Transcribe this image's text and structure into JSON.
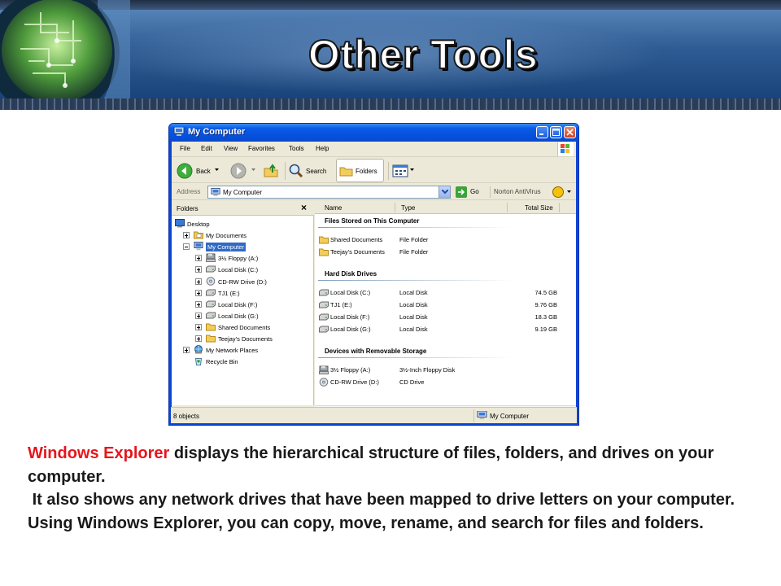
{
  "slide": {
    "title": "Other Tools",
    "paragraphs": [
      {
        "highlight": "Windows Explorer",
        "rest": " displays the hierarchical structure of files, folders, and drives on your computer."
      },
      {
        "text": " It also shows any network drives that have been mapped to drive letters on your computer."
      },
      {
        "text": "Using Windows Explorer, you can copy, move, rename, and search for files and folders."
      }
    ],
    "colors": {
      "header_blue": "#2e5b93",
      "highlight_red": "#e8141c",
      "xp_blue": "#0a5ce8",
      "selection": "#316ac5"
    }
  },
  "window": {
    "title": "My Computer",
    "menu": [
      "File",
      "Edit",
      "View",
      "Favorites",
      "Tools",
      "Help"
    ],
    "toolbar": {
      "back": "Back",
      "search": "Search",
      "folders": "Folders"
    },
    "address": {
      "label": "Address",
      "value": "My Computer",
      "go": "Go",
      "antivirus": "Norton AntiVirus"
    },
    "folders_pane": {
      "title": "Folders",
      "tree": [
        "Desktop",
        "My Documents",
        "My Computer",
        "3½ Floppy (A:)",
        "Local Disk (C:)",
        "CD-RW Drive (D:)",
        "TJ1 (E:)",
        "Local Disk (F:)",
        "Local Disk (G:)",
        "Shared Documents",
        "Teejay's Documents",
        "My Network Places",
        "Recycle Bin"
      ]
    },
    "columns": [
      "Name",
      "Type",
      "Total Size"
    ],
    "groups": [
      {
        "title": "Files Stored on This Computer",
        "rows": [
          {
            "name": "Shared Documents",
            "type": "File Folder",
            "size": ""
          },
          {
            "name": "Teejay's Documents",
            "type": "File Folder",
            "size": ""
          }
        ]
      },
      {
        "title": "Hard Disk Drives",
        "rows": [
          {
            "name": "Local Disk (C:)",
            "type": "Local Disk",
            "size": "74.5 GB"
          },
          {
            "name": "TJ1 (E:)",
            "type": "Local Disk",
            "size": "9.76 GB"
          },
          {
            "name": "Local Disk (F:)",
            "type": "Local Disk",
            "size": "18.3 GB"
          },
          {
            "name": "Local Disk (G:)",
            "type": "Local Disk",
            "size": "9.19 GB"
          }
        ]
      },
      {
        "title": "Devices with Removable Storage",
        "rows": [
          {
            "name": "3½ Floppy (A:)",
            "type": "3½-Inch Floppy Disk",
            "size": ""
          },
          {
            "name": "CD-RW Drive (D:)",
            "type": "CD Drive",
            "size": ""
          }
        ]
      }
    ],
    "status": {
      "count": "8 objects",
      "location": "My Computer"
    }
  }
}
